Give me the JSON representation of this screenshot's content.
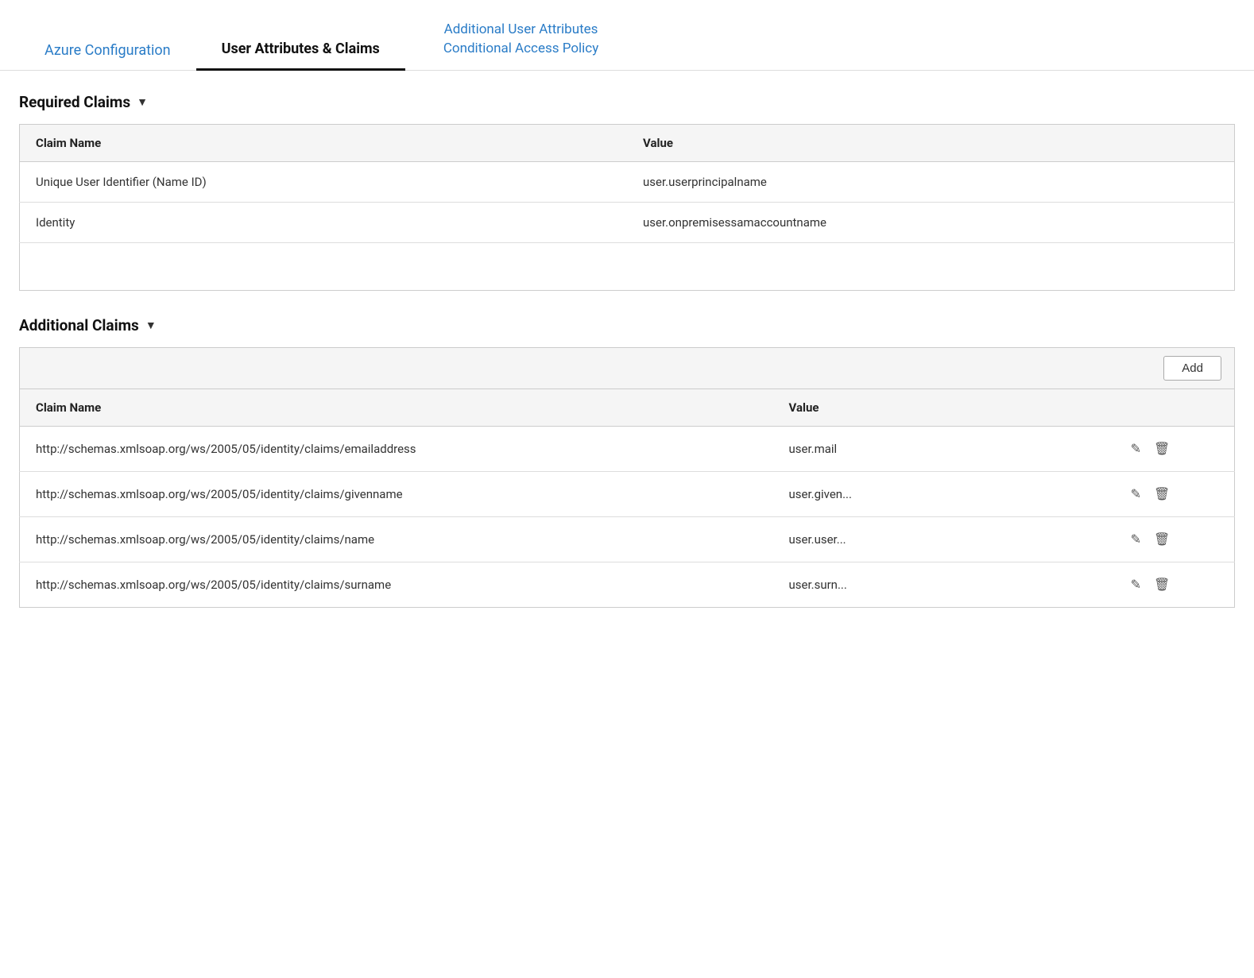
{
  "nav": {
    "tabs": [
      {
        "id": "azure-config",
        "label": "Azure Configuration",
        "active": false
      },
      {
        "id": "user-attributes",
        "label": "User Attributes & Claims",
        "active": true
      },
      {
        "id": "additional-right",
        "line1": "Additional User Attributes",
        "line2": "Conditional Access Policy",
        "active": false
      }
    ]
  },
  "required_claims": {
    "section_title": "Required Claims",
    "columns": {
      "name": "Claim Name",
      "value": "Value"
    },
    "rows": [
      {
        "claim_name": "Unique User Identifier (Name ID)",
        "value": "user.userprincipalname"
      },
      {
        "claim_name": "Identity",
        "value": "user.onpremisessamaccountname"
      }
    ]
  },
  "additional_claims": {
    "section_title": "Additional Claims",
    "add_button_label": "Add",
    "columns": {
      "name": "Claim Name",
      "value": "Value"
    },
    "rows": [
      {
        "claim_name": "http://schemas.xmlsoap.org/ws/2005/05/identity/claims/emailaddress",
        "value": "user.mail"
      },
      {
        "claim_name": "http://schemas.xmlsoap.org/ws/2005/05/identity/claims/givenname",
        "value": "user.given..."
      },
      {
        "claim_name": "http://schemas.xmlsoap.org/ws/2005/05/identity/claims/name",
        "value": "user.user..."
      },
      {
        "claim_name": "http://schemas.xmlsoap.org/ws/2005/05/identity/claims/surname",
        "value": "user.surn..."
      }
    ]
  },
  "icons": {
    "chevron_down": "▼",
    "edit": "✎",
    "delete": "🗑"
  }
}
